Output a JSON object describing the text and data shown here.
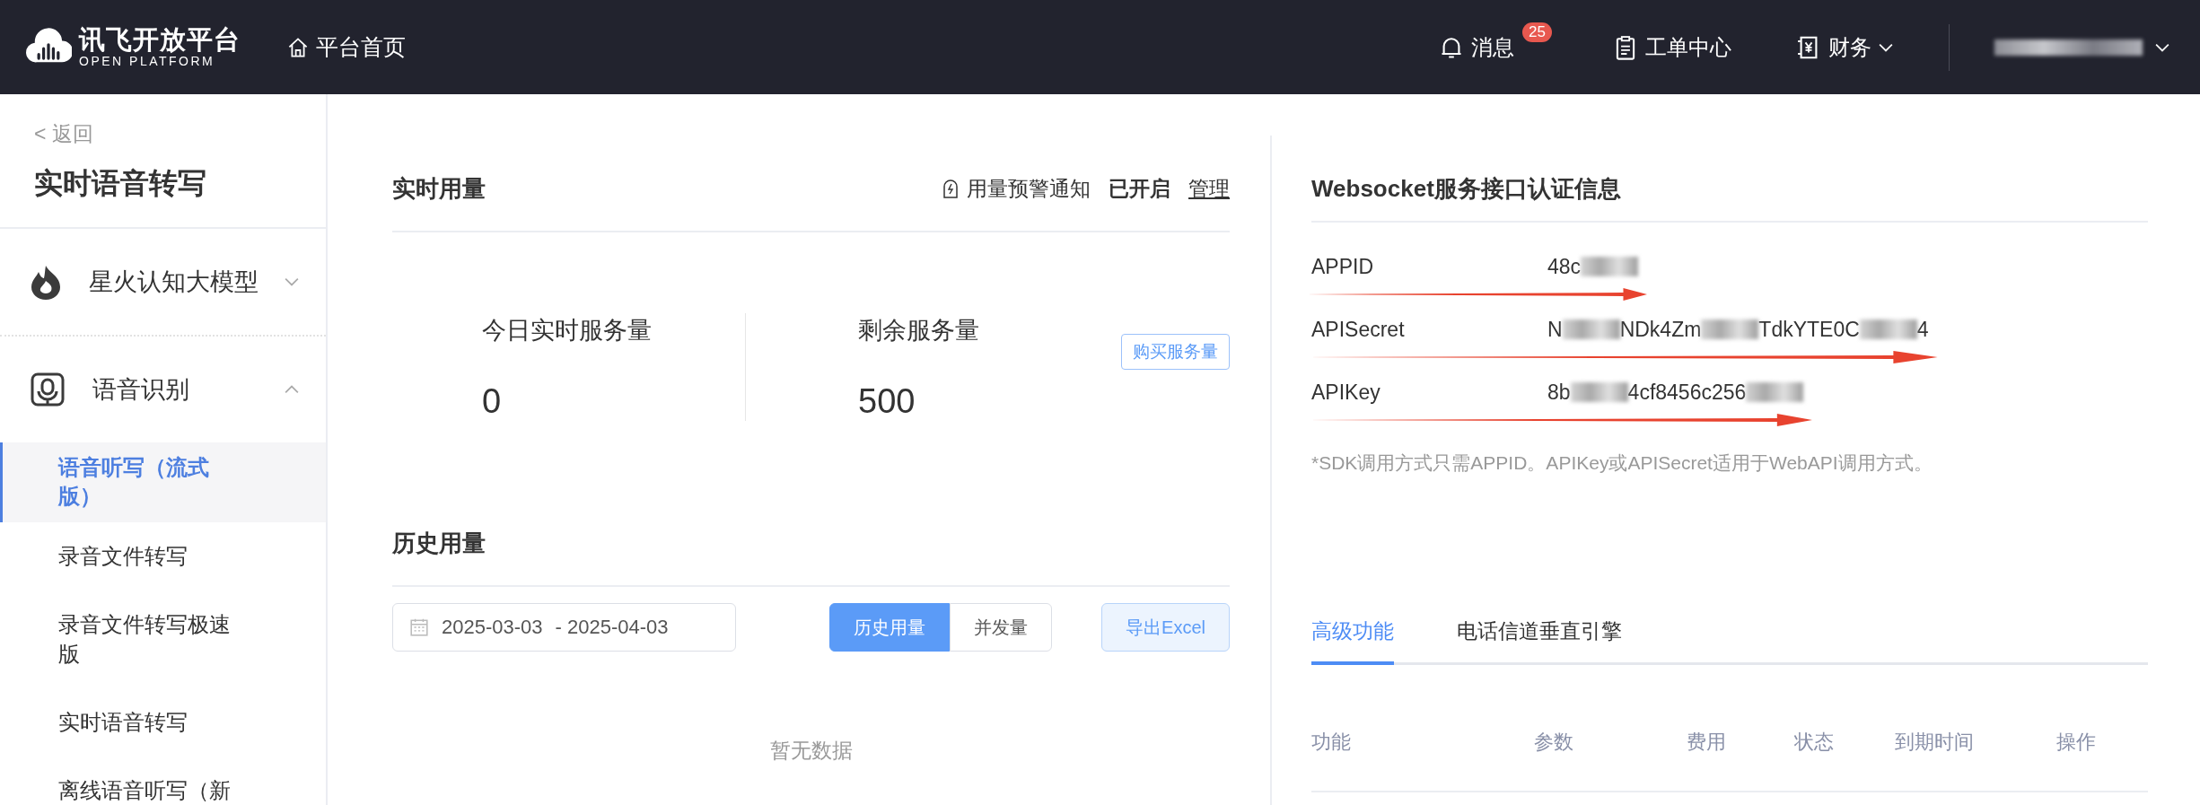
{
  "header": {
    "logo": {
      "name": "讯飞开放平台",
      "sub": "OPEN PLATFORM"
    },
    "home": "平台首页",
    "nav": [
      {
        "kind": "bell",
        "label": "消息",
        "badge": "25",
        "dropdown": false
      },
      {
        "kind": "clipboard",
        "label": "工单中心",
        "dropdown": false
      },
      {
        "kind": "wallet",
        "label": "财务",
        "dropdown": true
      }
    ]
  },
  "sidebar": {
    "back": "< 返回",
    "title": "实时语音转写",
    "groups": [
      {
        "kind": "flame",
        "label": "星火认知大模型",
        "expanded": false
      },
      {
        "kind": "mic",
        "label": "语音识别",
        "expanded": true,
        "items": [
          {
            "label": "语音听写（流式版）",
            "selected": true
          },
          {
            "label": "录音文件转写",
            "selected": false
          },
          {
            "label": "录音文件转写极速版",
            "selected": false
          },
          {
            "label": "实时语音转写",
            "selected": false
          },
          {
            "label": "离线语音听写（新",
            "selected": false
          }
        ]
      }
    ]
  },
  "realtime": {
    "title": "实时用量",
    "alert_label": "用量预警通知",
    "alert_status": "已开启",
    "manage": "管理",
    "stats": [
      {
        "label": "今日实时服务量",
        "value": "0"
      },
      {
        "label": "剩余服务量",
        "value": "500"
      }
    ],
    "buy": "购买服务量"
  },
  "history": {
    "title": "历史用量",
    "date_from": "2025-03-03",
    "date_to": "- 2025-04-03",
    "modes": [
      {
        "label": "历史用量",
        "selected": true
      },
      {
        "label": "并发量",
        "selected": false
      }
    ],
    "export": "导出Excel",
    "empty": "暂无数据"
  },
  "credentials": {
    "title": "Websocket服务接口认证信息",
    "rows": [
      {
        "label": "APPID",
        "arrow": true,
        "segments": [
          {
            "text": "48c",
            "masked": false
          },
          {
            "masked": true
          }
        ]
      },
      {
        "label": "APISecret",
        "arrow": true,
        "segments": [
          {
            "text": "N",
            "masked": false
          },
          {
            "masked": true
          },
          {
            "text": "NDk4Zm",
            "masked": false
          },
          {
            "masked": true
          },
          {
            "text": "TdkYTE0C",
            "masked": false
          },
          {
            "masked": true
          },
          {
            "text": "4",
            "masked": false
          }
        ]
      },
      {
        "label": "APIKey",
        "arrow": true,
        "segments": [
          {
            "text": "8b",
            "masked": false
          },
          {
            "masked": true
          },
          {
            "text": "4cf8456c256",
            "masked": false
          },
          {
            "masked": true
          }
        ]
      }
    ],
    "note": "*SDK调用方式只需APPID。APIKey或APISecret适用于WebAPI调用方式。"
  },
  "features": {
    "tabs": [
      {
        "label": "高级功能",
        "selected": true
      },
      {
        "label": "电话信道垂直引擎",
        "selected": false
      }
    ],
    "columns": [
      "功能",
      "参数",
      "费用",
      "状态",
      "到期时间",
      "操作"
    ]
  }
}
